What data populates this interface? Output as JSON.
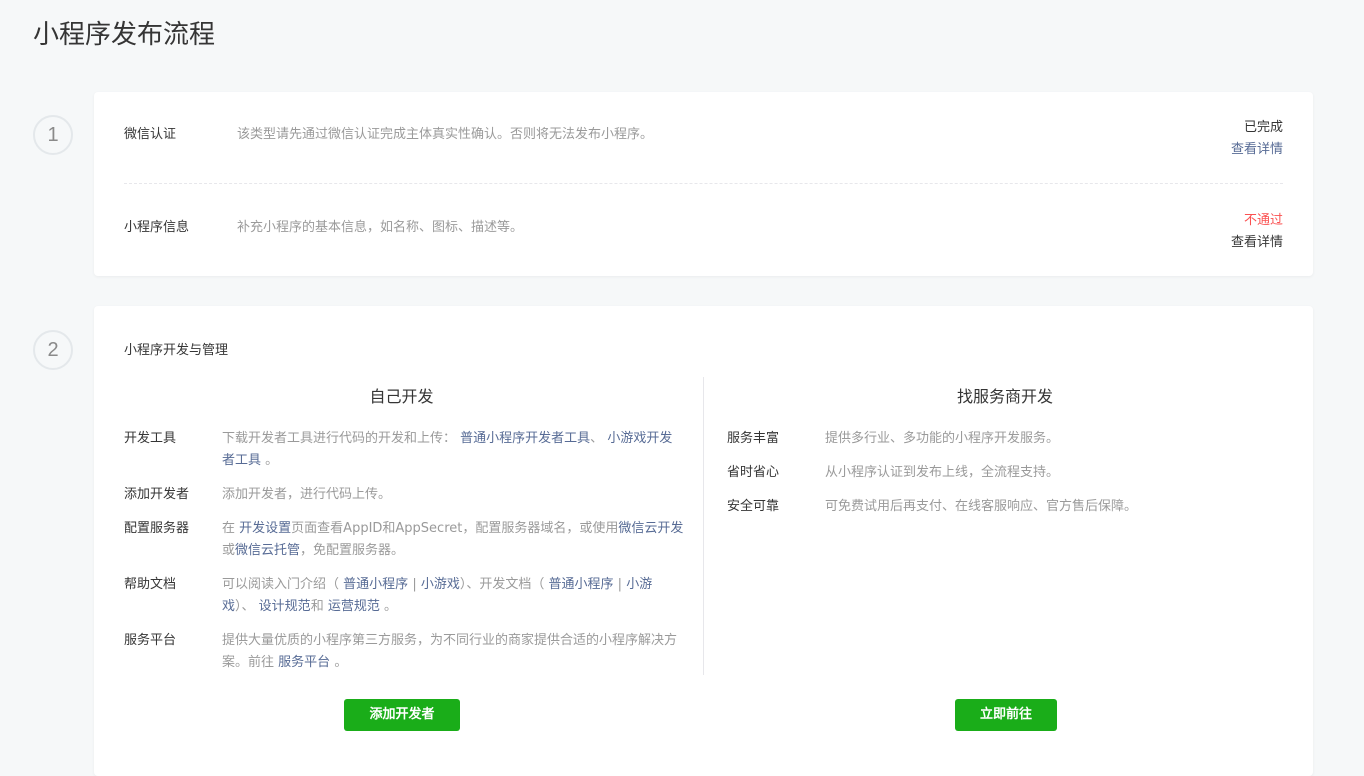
{
  "page": {
    "title": "小程序发布流程"
  },
  "steps": [
    "1",
    "2"
  ],
  "step1": {
    "rows": [
      {
        "label": "微信认证",
        "desc": "该类型请先通过微信认证完成主体真实性确认。否则将无法发布小程序。",
        "status": "已完成",
        "link": "查看详情"
      },
      {
        "label": "小程序信息",
        "desc": "补充小程序的基本信息，如名称、图标、描述等。",
        "status": "不通过",
        "link": "查看详情"
      }
    ]
  },
  "step2": {
    "title": "小程序开发与管理",
    "left": {
      "title": "自己开发",
      "button": "添加开发者",
      "items": {
        "tools": {
          "label": "开发工具",
          "t1": "下载开发者工具进行代码的开发和上传：",
          "l1": "普通小程序开发者工具",
          "t2": "、",
          "l2a": "小游戏",
          "l2b": "开发者工具",
          "t3": "。"
        },
        "dev": {
          "label": "添加开发者",
          "t1": "添加开发者，进行代码上传。"
        },
        "server": {
          "label": "配置服务器",
          "t1": "在",
          "l1": "开发设置",
          "t2": "页面查看AppID和AppSecret，配置服务器域名，或使用",
          "l2a": "微信",
          "l2b": "云开发",
          "t3": "或",
          "l3": "微信云托管",
          "t4": "，免配置服务器。"
        },
        "docs": {
          "label": "帮助文档",
          "t1": "可以阅读入门介绍（",
          "l1": "普通小程序",
          "t2": "|",
          "l2": "小游戏",
          "t3": "）、开发文档（",
          "l3": "普通小程序",
          "t4": "|",
          "l4a": "小",
          "l4b": "游戏",
          "t5": "）、",
          "l5": "设计规范",
          "t6": "和",
          "l6": "运营规范",
          "t7": "。"
        },
        "platform": {
          "label": "服务平台",
          "t1": "提供大量优质的小程序第三方服务，为不同行业的商家提供合适的小程序",
          "t2": "解决方案。前往",
          "l1": "服务平台",
          "t3": "。"
        }
      }
    },
    "right": {
      "title": "找服务商开发",
      "button": "立即前往",
      "items": [
        {
          "label": "服务丰富",
          "desc": "提供多行业、多功能的小程序开发服务。"
        },
        {
          "label": "省时省心",
          "desc": "从小程序认证到发布上线，全流程支持。"
        },
        {
          "label": "安全可靠",
          "desc": "可免费试用后再支付、在线客服响应、官方售后保障。"
        }
      ]
    }
  }
}
